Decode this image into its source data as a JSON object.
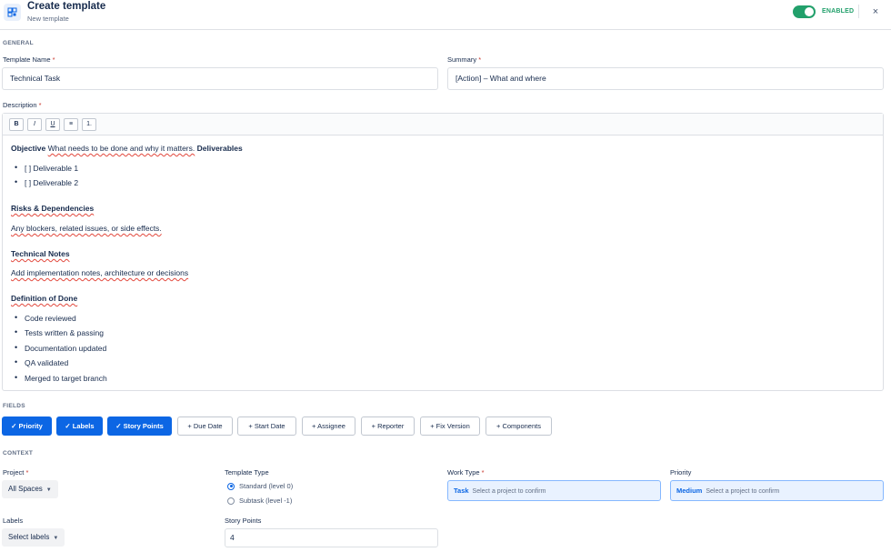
{
  "header": {
    "title": "Create template",
    "subtitle": "New template",
    "enabled_label": "ENABLED",
    "close_glyph": "×",
    "icon": "template-icon",
    "toggle_color": "#22a06b"
  },
  "general": {
    "section_label": "GENERAL",
    "template_name": {
      "label": "Template Name",
      "required": "*",
      "value": "Technical Task"
    },
    "summary": {
      "label": "Summary",
      "required": "*",
      "value": "[Action] – What and where"
    },
    "description": {
      "label": "Description",
      "required": "*",
      "toolbar": [
        "B",
        "I",
        "U",
        "≡",
        "1."
      ],
      "content": {
        "objective_heading": "Objective",
        "objective_text": "What needs to be done and why it matters.",
        "deliverables_heading": "Deliverables",
        "deliverables": [
          "[ ] Deliverable 1",
          "[ ] Deliverable 2"
        ],
        "risks_heading": "Risks & Dependencies",
        "risks_text": "Any blockers, related issues, or side effects.",
        "notes_heading": "Technical Notes",
        "notes_text": "Add implementation notes, architecture or decisions",
        "dod_heading": "Definition of Done",
        "dod_items": [
          "Code reviewed",
          "Tests written & passing",
          "Documentation updated",
          "QA validated",
          "Merged to target branch"
        ]
      }
    }
  },
  "fields": {
    "section_label": "FIELDS",
    "chips": [
      {
        "label": "✓ Priority",
        "active": true
      },
      {
        "label": "✓ Labels",
        "active": true
      },
      {
        "label": "✓ Story Points",
        "active": true
      },
      {
        "label": "+ Due Date",
        "active": false
      },
      {
        "label": "+ Start Date",
        "active": false
      },
      {
        "label": "+ Assignee",
        "active": false
      },
      {
        "label": "+ Reporter",
        "active": false
      },
      {
        "label": "+ Fix Version",
        "active": false
      },
      {
        "label": "+ Components",
        "active": false
      }
    ],
    "active_color": "#0c66e4"
  },
  "context": {
    "section_label": "CONTEXT",
    "project": {
      "label": "Project",
      "required": "*",
      "value": "All Spaces"
    },
    "template_type": {
      "label": "Template Type",
      "options": [
        {
          "label": "Standard (level 0)",
          "selected": true
        },
        {
          "label": "Subtask (level -1)",
          "selected": false
        }
      ]
    },
    "work_type": {
      "label": "Work Type",
      "required": "*",
      "value": "Task",
      "hint": "Select a project to confirm"
    },
    "priority": {
      "label": "Priority",
      "value": "Medium",
      "hint": "Select a project to confirm"
    },
    "labels": {
      "label": "Labels",
      "value": "Select labels"
    },
    "story_points": {
      "label": "Story Points",
      "value": "4"
    }
  }
}
